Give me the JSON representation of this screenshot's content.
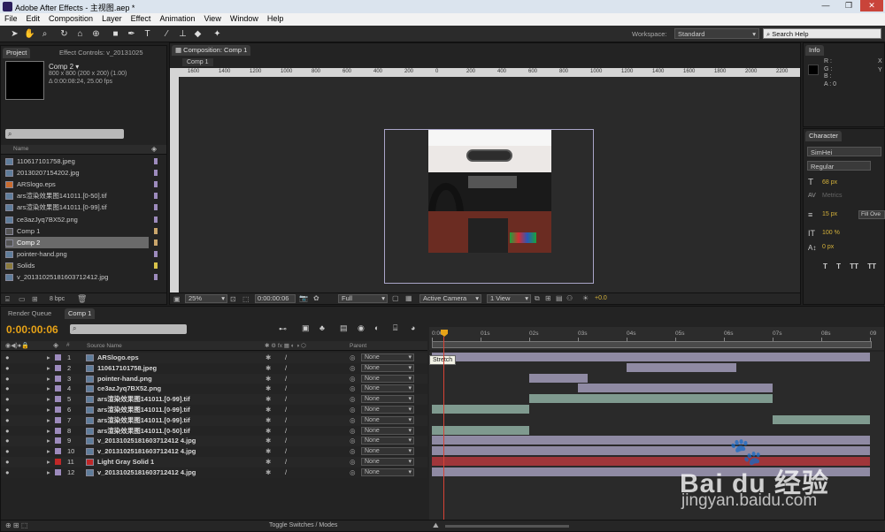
{
  "title": "Adobe After Effects - 主视图.aep *",
  "menu": [
    "File",
    "Edit",
    "Composition",
    "Layer",
    "Effect",
    "Animation",
    "View",
    "Window",
    "Help"
  ],
  "workspace": {
    "label": "Workspace:",
    "value": "Standard"
  },
  "search_help": "Search Help",
  "project": {
    "tab_project": "Project",
    "tab_effect": "Effect Controls: v_20131025",
    "comp_name": "Comp 2 ▾",
    "comp_info1": "800 x 800  (200 x 200) (1.00)",
    "comp_info2": "Δ 0:00:08:24, 25.00 fps",
    "search_icon": "⌕",
    "col_name": "Name",
    "items": [
      {
        "name": "110617101758.jpeg",
        "type": "img"
      },
      {
        "name": "20130207154202.jpg",
        "type": "img"
      },
      {
        "name": "ARSlogo.eps",
        "type": "eps"
      },
      {
        "name": "ars渲染效果图141011.[0-50].tif",
        "type": "seq"
      },
      {
        "name": "ars渲染效果图141011.[0-99].tif",
        "type": "seq"
      },
      {
        "name": "ce3azJyq7BX52.png",
        "type": "img"
      },
      {
        "name": "Comp 1",
        "type": "comp"
      },
      {
        "name": "Comp 2",
        "type": "comp",
        "selected": true
      },
      {
        "name": "pointer-hand.png",
        "type": "img"
      },
      {
        "name": "Solids",
        "type": "folder"
      },
      {
        "name": "v_20131025181603712412.jpg",
        "type": "img"
      }
    ],
    "bpc": "8 bpc"
  },
  "composition": {
    "tab": "Composition: Comp 1",
    "subtab": "Comp 1",
    "ruler": [
      "1600",
      "1400",
      "1200",
      "1000",
      "800",
      "600",
      "400",
      "200",
      "0",
      "200",
      "400",
      "600",
      "800",
      "1000",
      "1200",
      "1400",
      "1600",
      "1800",
      "2000",
      "2200"
    ],
    "zoom": "25%",
    "timecode": "0:00:00:06",
    "resolution": "Full",
    "camera": "Active Camera",
    "view": "1 View",
    "exposure": "+0.0"
  },
  "info": {
    "tab": "Info",
    "r": "R :",
    "g": "G :",
    "b": "B :",
    "a": "A : 0",
    "x": "X",
    "y": "Y"
  },
  "character": {
    "tab": "Character",
    "font": "SimHei",
    "style": "Regular",
    "size": "68 px",
    "metrics": "Metrics",
    "leading": "15 px",
    "fill": "Fill Ove",
    "scale": "100 %",
    "shift": "0 px",
    "t_buttons": [
      "T",
      "T",
      "TT",
      "TT",
      "T"
    ]
  },
  "timeline": {
    "tab_render": "Render Queue",
    "tab_comp": "Comp 1",
    "timecode": "0:00:00:06",
    "col_source": "Source Name",
    "col_parent": "Parent",
    "col_num": "#",
    "ruler": [
      "0:00s",
      "01s",
      "02s",
      "03s",
      "04s",
      "05s",
      "06s",
      "07s",
      "08s",
      "09"
    ],
    "tooltip": "Stretch",
    "toggle": "Toggle Switches / Modes",
    "layers": [
      {
        "n": "1",
        "name": "ARSlogo.eps",
        "color": "#9d8bbd",
        "parent": "None"
      },
      {
        "n": "2",
        "name": "110617101758.jpeg",
        "color": "#9d8bbd",
        "parent": "None"
      },
      {
        "n": "3",
        "name": "pointer-hand.png",
        "color": "#9d8bbd",
        "parent": "None"
      },
      {
        "n": "4",
        "name": "ce3azJyq7BX52.png",
        "color": "#9d8bbd",
        "parent": "None"
      },
      {
        "n": "5",
        "name": "ars渲染效果图141011.[0-99].tif",
        "color": "#9d8bbd",
        "parent": "None"
      },
      {
        "n": "6",
        "name": "ars渲染效果图141011.[0-99].tif",
        "color": "#9d8bbd",
        "parent": "None"
      },
      {
        "n": "7",
        "name": "ars渲染效果图141011.[0-99].tif",
        "color": "#9d8bbd",
        "parent": "None"
      },
      {
        "n": "8",
        "name": "ars渲染效果图141011.[0-50].tif",
        "color": "#9d8bbd",
        "parent": "None"
      },
      {
        "n": "9",
        "name": "v_20131025181603712412 4.jpg",
        "color": "#9d8bbd",
        "parent": "None"
      },
      {
        "n": "10",
        "name": "v_20131025181603712412 4.jpg",
        "color": "#9d8bbd",
        "parent": "None"
      },
      {
        "n": "11",
        "name": "Light Gray Solid 1",
        "color": "#c02828",
        "parent": "None"
      },
      {
        "n": "12",
        "name": "v_20131025181603712412 4.jpg",
        "color": "#9d8bbd",
        "parent": "None"
      }
    ],
    "bars": [
      {
        "start": 0.0,
        "end": 9.0,
        "color": "#8f8aa3"
      },
      {
        "start": 4.0,
        "end": 6.25,
        "color": "#8f8aa3"
      },
      {
        "start": 2.0,
        "end": 3.2,
        "color": "#8f8aa3"
      },
      {
        "start": 3.0,
        "end": 7.0,
        "color": "#8f8aa3"
      },
      {
        "start": 2.0,
        "end": 7.0,
        "color": "#7f9a8f"
      },
      {
        "start": 0.0,
        "end": 2.0,
        "color": "#7f9a8f"
      },
      {
        "start": 7.0,
        "end": 9.0,
        "color": "#7f9a8f"
      },
      {
        "start": 0.0,
        "end": 2.0,
        "color": "#7f9a8f"
      },
      {
        "start": 0.0,
        "end": 9.0,
        "color": "#8f8aa3"
      },
      {
        "start": 0.0,
        "end": 9.0,
        "color": "#8f8aa3"
      },
      {
        "start": 0.0,
        "end": 9.0,
        "color": "#a0363a"
      },
      {
        "start": 0.0,
        "end": 9.0,
        "color": "#8f8aa3"
      }
    ]
  },
  "watermark": {
    "brand": "Bai du 经验",
    "url": "jingyan.baidu.com"
  }
}
